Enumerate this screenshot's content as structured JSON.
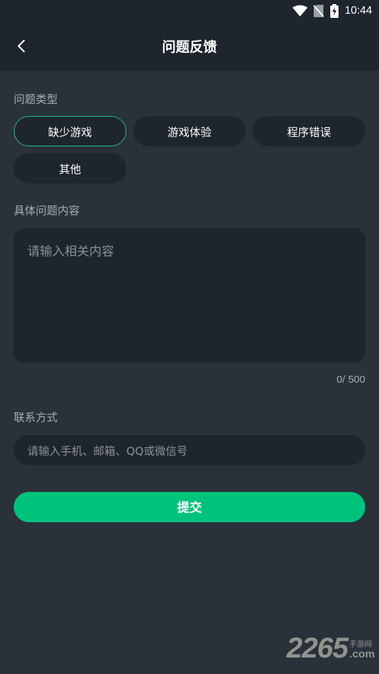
{
  "status_bar": {
    "time": "10:44"
  },
  "header": {
    "title": "问题反馈"
  },
  "issue_type": {
    "label": "问题类型",
    "options": [
      "缺少游戏",
      "游戏体验",
      "程序错误",
      "其他"
    ],
    "selected": "缺少游戏"
  },
  "content": {
    "label": "具体问题内容",
    "placeholder": "请输入相关内容",
    "counter": "0/ 500"
  },
  "contact": {
    "label": "联系方式",
    "placeholder": "请输入手机、邮箱、QQ或微信号"
  },
  "submit_label": "提交",
  "watermark": {
    "number": "2265",
    "site_cn": "手游网",
    "domain": ".com"
  },
  "colors": {
    "accent": "#00c37b",
    "background": "#29313b",
    "header": "#1f252c"
  }
}
